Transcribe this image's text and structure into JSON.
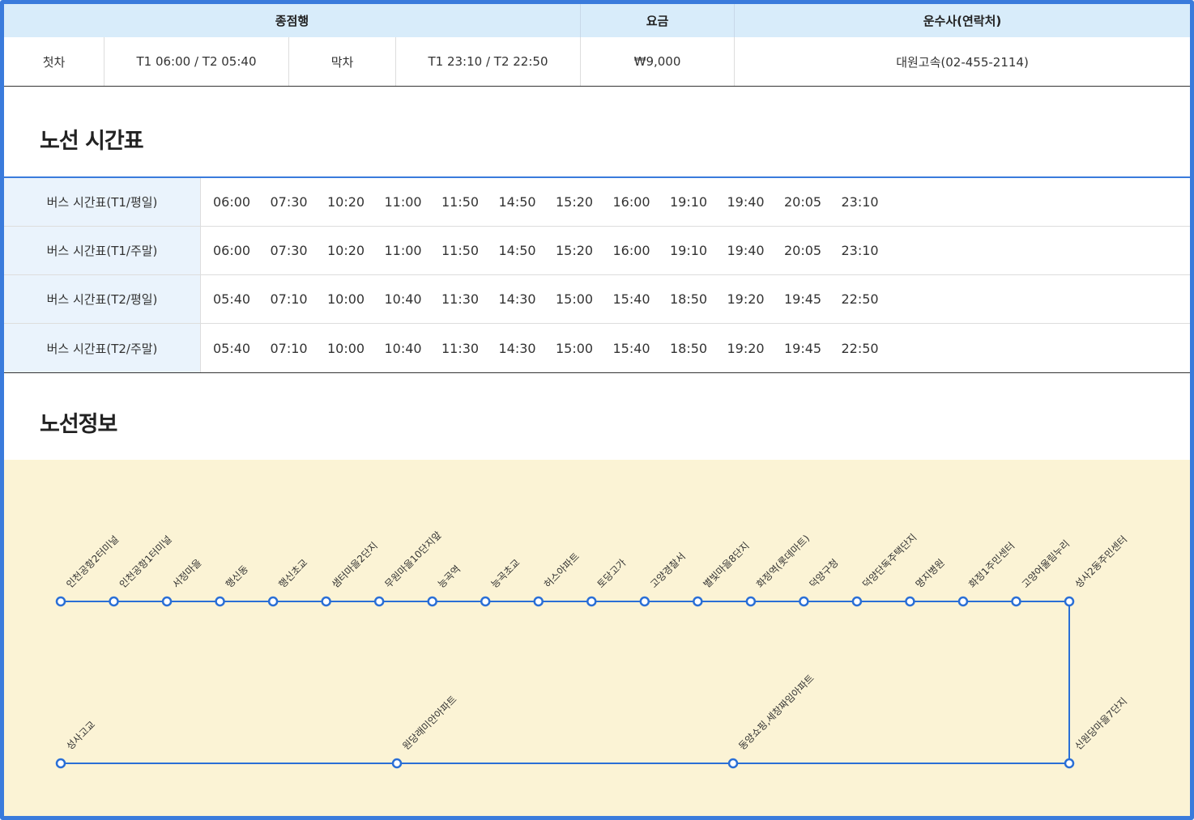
{
  "summary": {
    "headers": {
      "terminal": "종점행",
      "fare": "요금",
      "operator": "운수사(연락처)"
    },
    "first_label": "첫차",
    "first_value": "T1 06:00 / T2 05:40",
    "last_label": "막차",
    "last_value": "T1 23:10 / T2 22:50",
    "fare": "₩9,000",
    "operator": "대원고속(02-455-2114)"
  },
  "timetable": {
    "title": "노선 시간표",
    "rows": [
      {
        "label": "버스 시간표(T1/평일)",
        "times": [
          "06:00",
          "07:30",
          "10:20",
          "11:00",
          "11:50",
          "14:50",
          "15:20",
          "16:00",
          "19:10",
          "19:40",
          "20:05",
          "23:10"
        ]
      },
      {
        "label": "버스 시간표(T1/주말)",
        "times": [
          "06:00",
          "07:30",
          "10:20",
          "11:00",
          "11:50",
          "14:50",
          "15:20",
          "16:00",
          "19:10",
          "19:40",
          "20:05",
          "23:10"
        ]
      },
      {
        "label": "버스 시간표(T2/평일)",
        "times": [
          "05:40",
          "07:10",
          "10:00",
          "10:40",
          "11:30",
          "14:30",
          "15:00",
          "15:40",
          "18:50",
          "19:20",
          "19:45",
          "22:50"
        ]
      },
      {
        "label": "버스 시간표(T2/주말)",
        "times": [
          "05:40",
          "07:10",
          "10:00",
          "10:40",
          "11:30",
          "14:30",
          "15:00",
          "15:40",
          "18:50",
          "19:20",
          "19:45",
          "22:50"
        ]
      }
    ]
  },
  "route": {
    "title": "노선정보",
    "top_stops": [
      "인천공항2터미널",
      "인천공항1터미널",
      "서정마을",
      "행신동",
      "행신초교",
      "샘터마을2단지",
      "무원마을10단지앞",
      "능곡역",
      "능곡초교",
      "허스아파트",
      "토당고가",
      "고양경찰서",
      "별빛마을8단지",
      "화정역(롯데마트)",
      "덕양구청",
      "덕양단독주택단지",
      "명지병원",
      "화정1주민센터",
      "고양어울림누리",
      "성사2동주민센터"
    ],
    "bottom_stops_left_to_right": [
      "성사고교",
      "원당래미안아파트",
      "동양쇼핑,세창짜임아파트",
      "신원당마을7단지"
    ]
  },
  "colors": {
    "accent": "#3a7bdc",
    "header_bg": "#d8ecfa",
    "label_bg": "#eaf3fc",
    "route_bg": "#fbf3d5",
    "route_line": "#2a6fd6"
  }
}
